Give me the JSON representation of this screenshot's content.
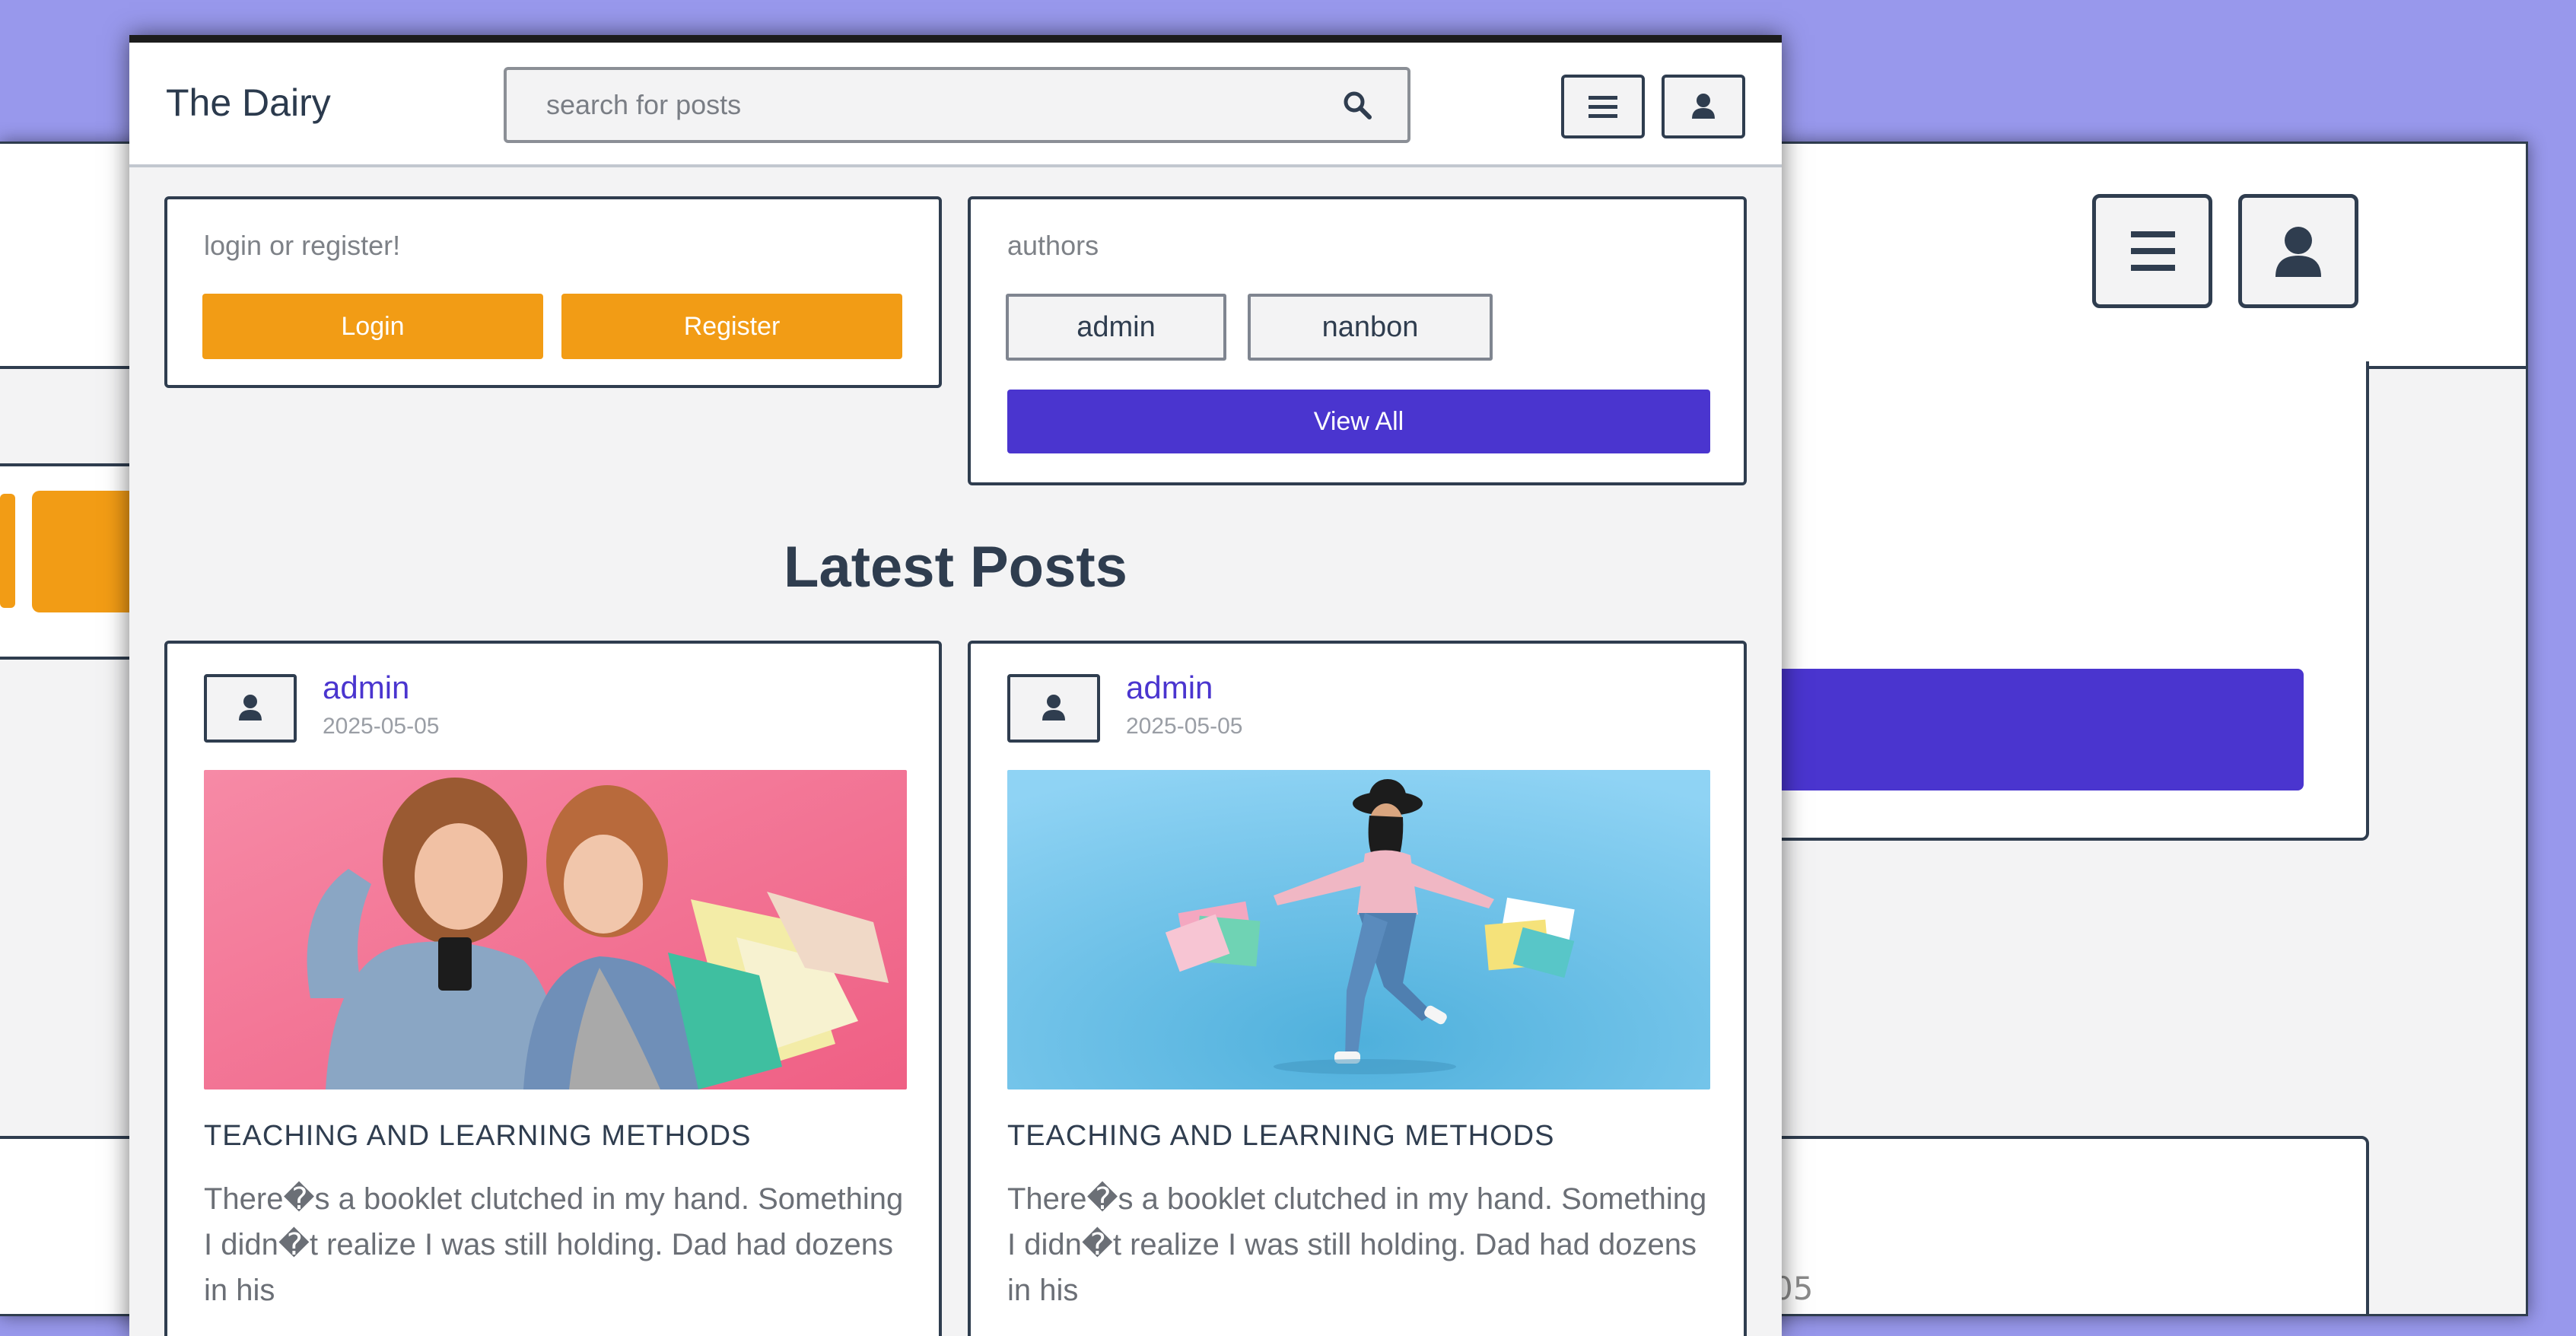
{
  "background_window": {
    "partial_date_text": "05"
  },
  "header": {
    "brand": "The Dairy",
    "search_placeholder": "search for posts",
    "search_icon": "search-icon",
    "menu_icon": "hamburger-menu-icon",
    "user_icon": "user-icon"
  },
  "auth_card": {
    "label": "login or register!",
    "login_label": "Login",
    "register_label": "Register"
  },
  "authors_card": {
    "label": "authors",
    "authors": [
      "admin",
      "nanbon"
    ],
    "view_all_label": "View All"
  },
  "latest": {
    "title": "Latest Posts",
    "posts": [
      {
        "author": "admin",
        "date": "2025-05-05",
        "image": "two-women-shopping-bags-photo",
        "title": "TEACHING AND LEARNING METHODS",
        "excerpt": "There�s a booklet clutched in my hand. Something I didn�t realize I was still holding. Dad had dozens in his"
      },
      {
        "author": "admin",
        "date": "2025-05-05",
        "image": "woman-jumping-shopping-bags-photo",
        "title": "TEACHING AND LEARNING METHODS",
        "excerpt": "There�s a booklet clutched in my hand. Something I didn�t realize I was still holding. Dad had dozens in his"
      }
    ]
  },
  "colors": {
    "desktop_bg": "#9898ec",
    "accent_orange": "#f29c15",
    "accent_purple": "#4a35cf",
    "text_dark": "#2f3d4f",
    "page_bg": "#f3f3f4"
  }
}
